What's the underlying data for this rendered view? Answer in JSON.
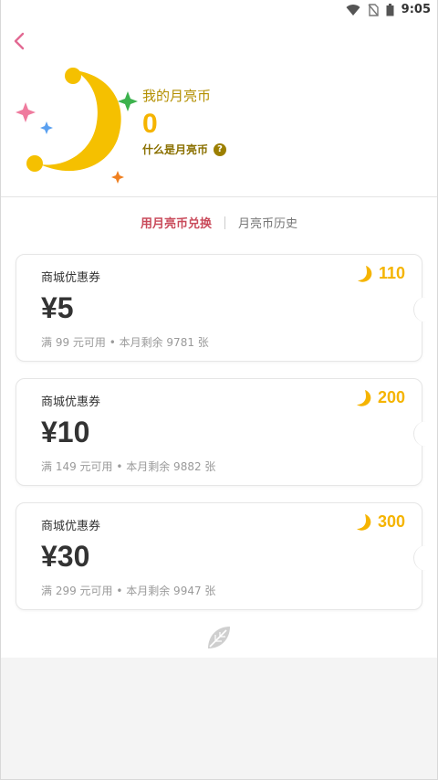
{
  "status_bar": {
    "time": "9:05"
  },
  "header": {
    "label": "我的月亮币",
    "amount": "0",
    "what_is": "什么是月亮币",
    "help_mark": "?"
  },
  "tabs": [
    {
      "label": "用月亮币兑换",
      "active": true
    },
    {
      "label": "月亮币历史",
      "active": false
    }
  ],
  "coupons": [
    {
      "title": "商城优惠券",
      "price": "¥5",
      "cost": "110",
      "desc": "满 99 元可用 • 本月剩余 9781 张"
    },
    {
      "title": "商城优惠券",
      "price": "¥10",
      "cost": "200",
      "desc": "满 149 元可用 • 本月剩余 9882 张"
    },
    {
      "title": "商城优惠券",
      "price": "¥30",
      "cost": "300",
      "desc": "满 299 元可用 • 本月剩余 9947 张"
    }
  ],
  "colors": {
    "accent_pink": "#e26a93",
    "gold": "#f5b400",
    "tab_active": "#c94a5a"
  }
}
